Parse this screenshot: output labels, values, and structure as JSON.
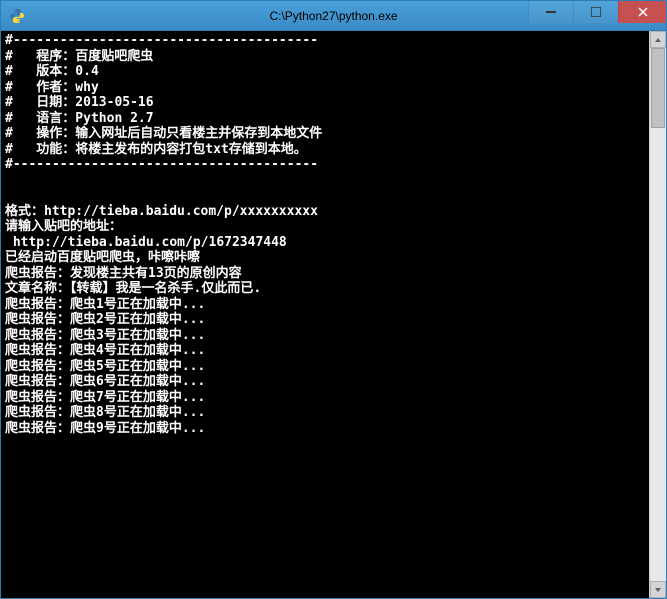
{
  "titlebar": {
    "title": "C:\\Python27\\python.exe"
  },
  "terminal": {
    "divider": "#---------------------------------------",
    "header": [
      "#   程序：百度贴吧爬虫",
      "#   版本：0.4",
      "#   作者：why",
      "#   日期：2013-05-16",
      "#   语言：Python 2.7",
      "#   操作：输入网址后自动只看楼主并保存到本地文件",
      "#   功能：将楼主发布的内容打包txt存储到本地。"
    ],
    "blank": "",
    "format_line": "格式：http://tieba.baidu.com/p/xxxxxxxxxx",
    "prompt_line": "请输入贴吧的地址：",
    "url_line": " http://tieba.baidu.com/p/1672347448",
    "started_line": "已经启动百度贴吧爬虫，咔嚓咔嚓",
    "pages_line": "爬虫报告：发现楼主共有13页的原创内容",
    "title_line": "文章名称：【转载】我是一名杀手.仅此而已.",
    "workers": [
      "爬虫报告：爬虫1号正在加载中...",
      "爬虫报告：爬虫2号正在加载中...",
      "爬虫报告：爬虫3号正在加载中...",
      "爬虫报告：爬虫4号正在加载中...",
      "爬虫报告：爬虫5号正在加载中...",
      "爬虫报告：爬虫6号正在加载中...",
      "爬虫报告：爬虫7号正在加载中...",
      "爬虫报告：爬虫8号正在加载中...",
      "爬虫报告：爬虫9号正在加载中..."
    ]
  }
}
